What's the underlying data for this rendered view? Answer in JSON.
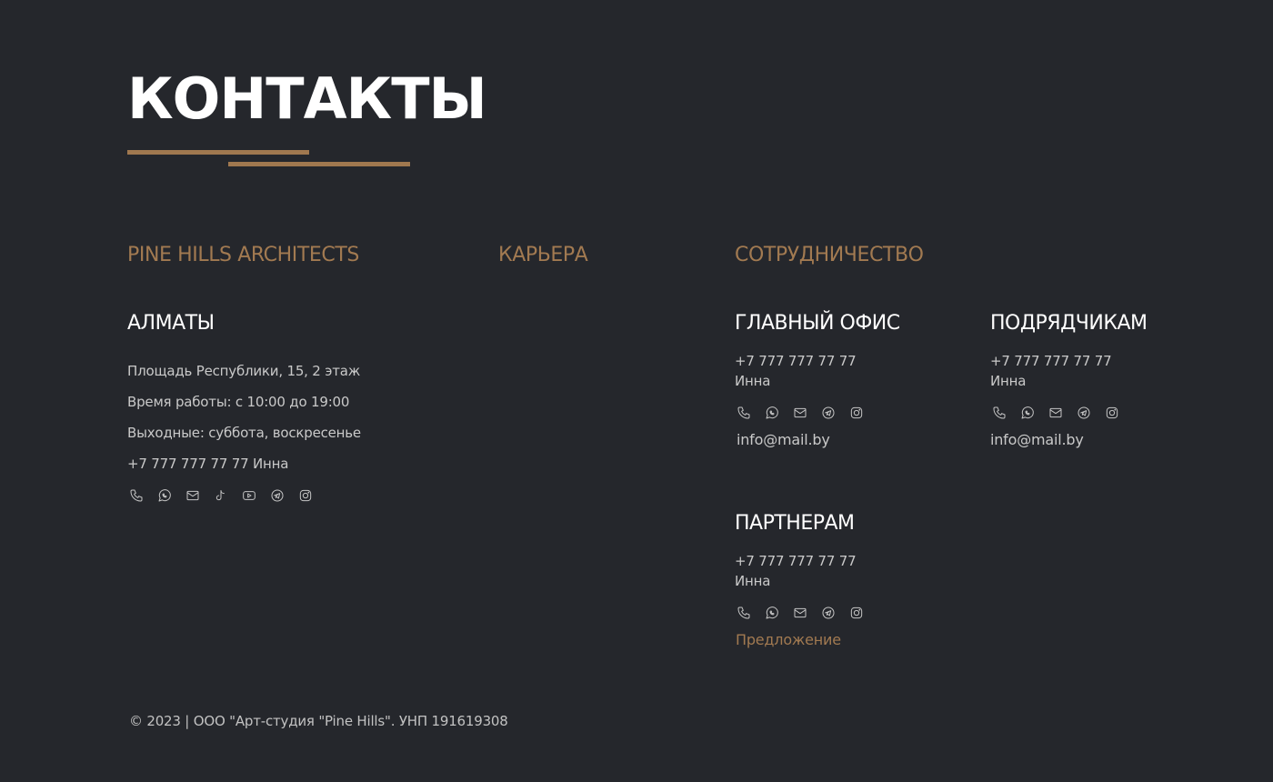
{
  "page": {
    "title": "КОНТАКТЫ",
    "accent_color": "#a0784f",
    "background_color": "#25272c"
  },
  "tabs": [
    {
      "label": "PINE HILLS ARCHITECTS"
    },
    {
      "label": "КАРЬЕРА"
    },
    {
      "label": "СОТРУДНИЧЕСТВО"
    }
  ],
  "almaty": {
    "heading": "АЛМАТЫ",
    "address": "Площадь Республики, 15, 2 этаж",
    "hours": "Время работы: с 10:00 до 19:00",
    "days_off": "Выходные: суббота, воскресенье",
    "phone": "+7 777 777 77 77 Инна",
    "icons": [
      "phone-icon",
      "whatsapp-icon",
      "mail-icon",
      "tiktok-icon",
      "youtube-icon",
      "telegram-icon",
      "instagram-icon"
    ]
  },
  "main_office": {
    "heading": "ГЛАВНЫЙ ОФИС",
    "phone": "+7 777 777 77 77",
    "contact_name": "Инна",
    "email": "info@mail.by",
    "icons": [
      "phone-icon",
      "whatsapp-icon",
      "mail-icon",
      "telegram-icon",
      "instagram-icon"
    ]
  },
  "contractors": {
    "heading": "ПОДРЯДЧИКАМ",
    "phone": "+7 777 777 77 77",
    "contact_name": "Инна",
    "email": "info@mail.by",
    "icons": [
      "phone-icon",
      "whatsapp-icon",
      "mail-icon",
      "telegram-icon",
      "instagram-icon"
    ]
  },
  "partners": {
    "heading": "ПАРТНЕРАМ",
    "phone": "+7 777 777 77 77",
    "contact_name": "Инна",
    "offer_link": "Предложение",
    "icons": [
      "phone-icon",
      "whatsapp-icon",
      "mail-icon",
      "telegram-icon",
      "instagram-icon"
    ]
  },
  "footer": {
    "copyright": "© 2023 | ООО \"Арт-студия \"Pine Hills\". УНП 191619308"
  }
}
